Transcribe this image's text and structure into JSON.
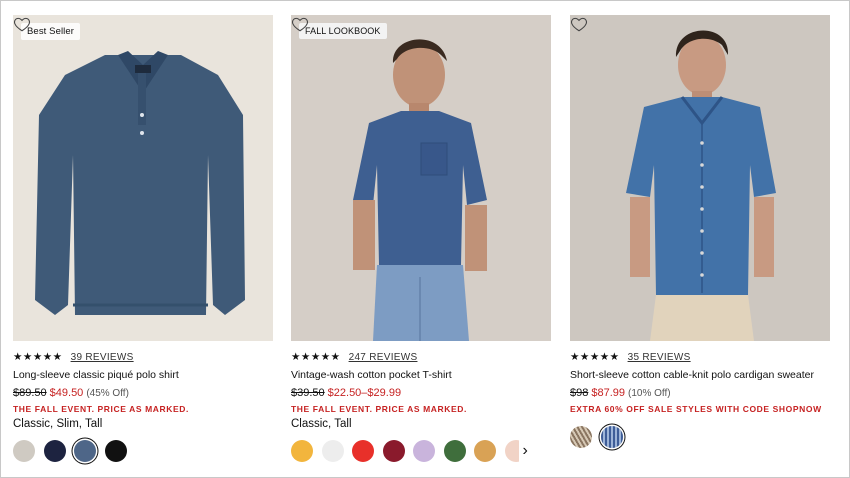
{
  "products": [
    {
      "badge": "Best Seller",
      "stars": "★★★★★",
      "reviews": "39 REVIEWS",
      "name": "Long-sleeve classic piqué polo shirt",
      "orig_price": "$89.50",
      "sale_price": "$49.50",
      "discount": "(45% Off)",
      "promo": "THE FALL EVENT. PRICE AS MARKED.",
      "fits": "Classic, Slim, Tall",
      "swatches": [
        "#cfcac2",
        "#1d2340",
        "#4e6688",
        "#111111"
      ]
    },
    {
      "badge": "FALL LOOKBOOK",
      "stars": "★★★★★",
      "reviews": "247 REVIEWS",
      "name": "Vintage-wash cotton pocket T-shirt",
      "orig_price": "$39.50",
      "sale_price": "$22.50–$29.99",
      "discount": "",
      "promo": "THE FALL EVENT. PRICE AS MARKED.",
      "fits": "Classic, Tall",
      "swatches": [
        "#f2b53d",
        "#ededed",
        "#e8302a",
        "#8a1a2c",
        "#c9b4dc",
        "#3f6e3c",
        "#d9a255",
        "#f1d3c6"
      ]
    },
    {
      "badge": "",
      "stars": "★★★★★",
      "reviews": "35 REVIEWS",
      "name": "Short-sleeve cotton cable-knit polo cardigan sweater",
      "orig_price": "$98",
      "sale_price": "$87.99",
      "discount": "(10% Off)",
      "promo": "EXTRA 60% OFF SALE STYLES WITH CODE SHOPNOW",
      "fits": "",
      "swatches": [
        "#b8a48c",
        "#3e5d98"
      ]
    }
  ],
  "colors": {
    "sale": "#c62222",
    "text": "#111111"
  },
  "icons": {
    "favorite": "heart-outline-icon",
    "more": "chevron-right-icon"
  }
}
